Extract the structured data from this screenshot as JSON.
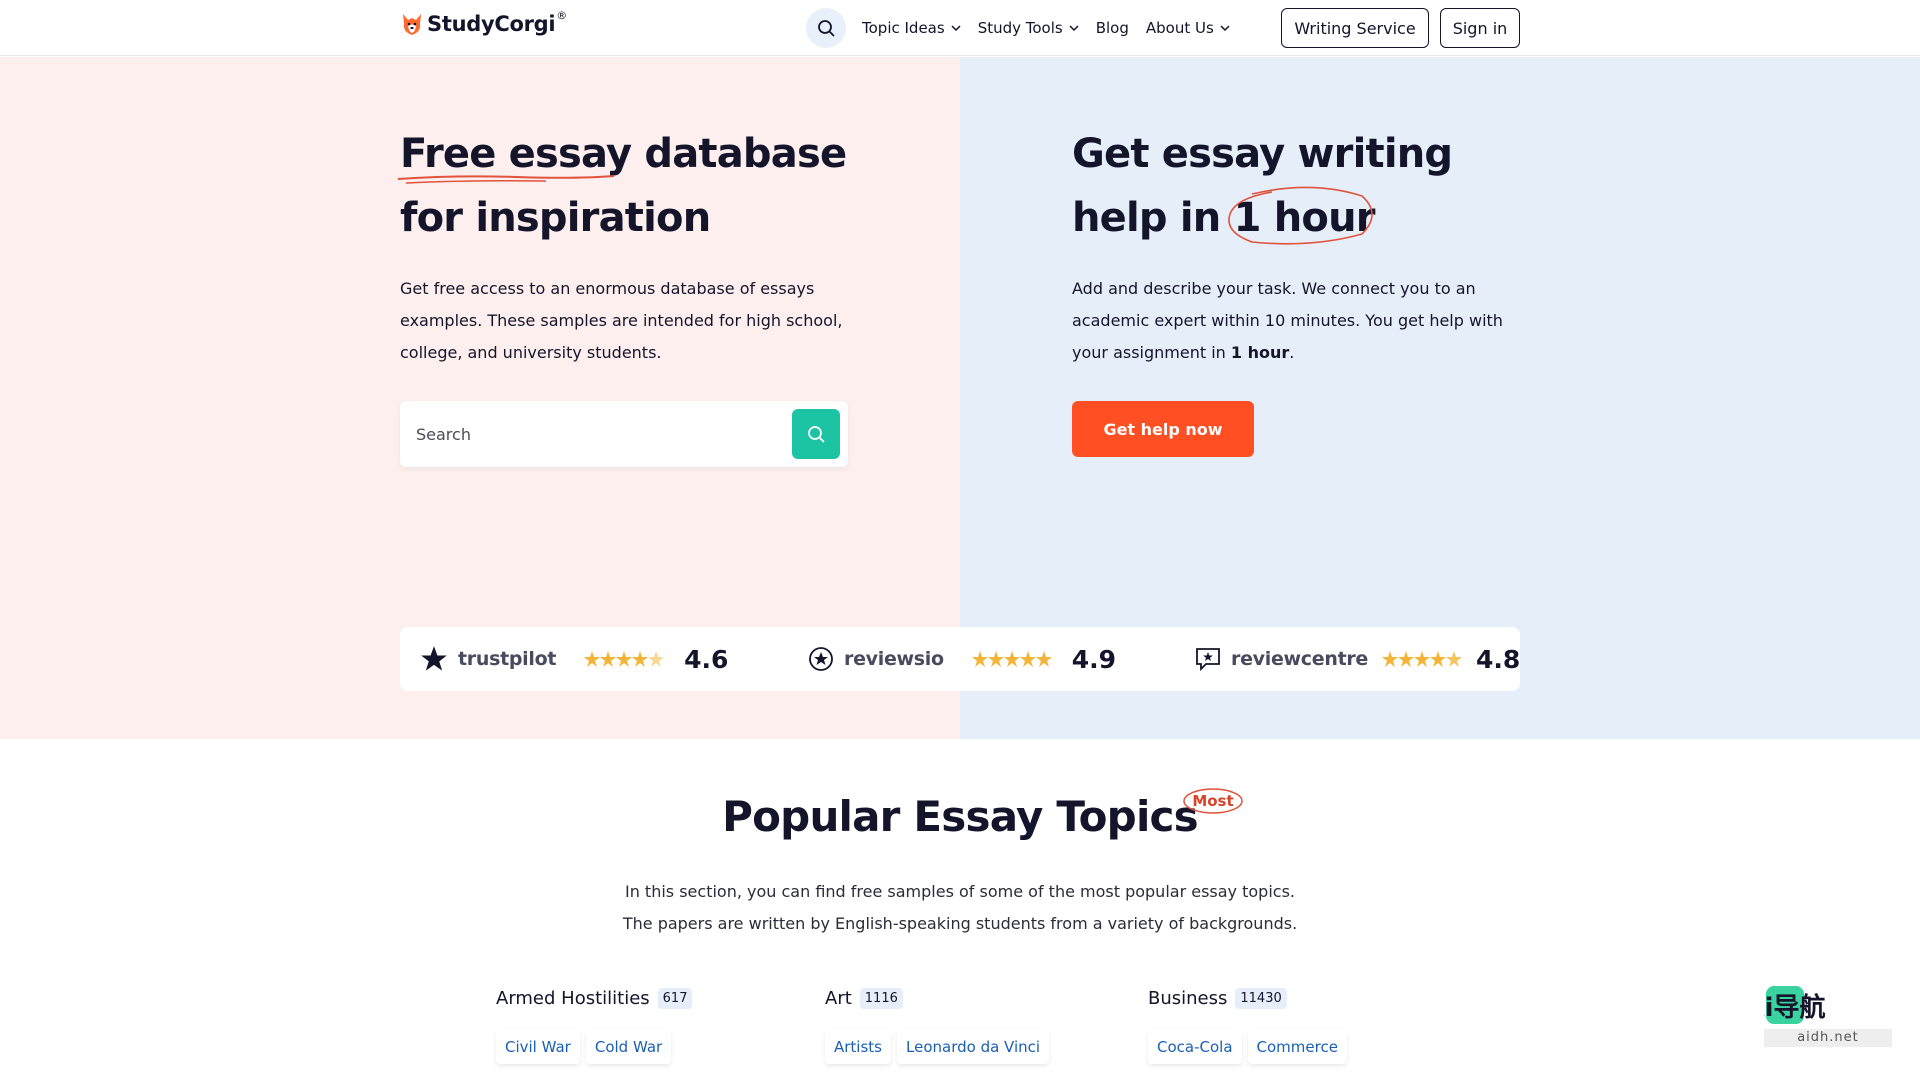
{
  "header": {
    "logo_text": "StudyCorgi",
    "logo_reg": "®",
    "nav": [
      {
        "label": "Topic Ideas",
        "has_dropdown": true
      },
      {
        "label": "Study Tools",
        "has_dropdown": true
      },
      {
        "label": "Blog",
        "has_dropdown": false
      },
      {
        "label": "About Us",
        "has_dropdown": true
      }
    ],
    "writing_service_label": "Writing Service",
    "sign_in_label": "Sign in"
  },
  "hero_left": {
    "title_line1_highlight": "Free essay",
    "title_line1_rest": " database",
    "title_line2": "for inspiration",
    "description": "Get free access to an enormous database of essays examples. These samples are intended for high school, college, and university students.",
    "search_placeholder": "Search"
  },
  "hero_right": {
    "title_line1": "Get essay writing",
    "title_line2_prefix": "help in ",
    "title_line2_highlight": "1 hour",
    "description_before": "Add and describe your task. We connect you to an academic expert within 10 minutes. You get help with your assignment in ",
    "description_bold": "1 hour",
    "description_after": ".",
    "cta_label": "Get help now"
  },
  "ratings": [
    {
      "brand": "trustpilot",
      "score": "4.6",
      "icon": "trustpilot-star-icon"
    },
    {
      "brand": "reviewsio",
      "score": "4.9",
      "icon": "reviewsio-icon"
    },
    {
      "brand": "reviewcentre",
      "score": "4.8",
      "icon": "reviewcentre-icon"
    }
  ],
  "popular": {
    "title": "Popular Essay Topics",
    "badge": "Most",
    "description_line1": "In this section, you can find free samples of some of the most popular essay topics.",
    "description_line2": "The papers are written by English-speaking students from a variety of backgrounds.",
    "categories": [
      {
        "name": "Armed Hostilities",
        "count": "617",
        "tags": [
          "Civil War",
          "Cold War"
        ]
      },
      {
        "name": "Art",
        "count": "1116",
        "tags": [
          "Artists",
          "Leonardo da Vinci"
        ]
      },
      {
        "name": "Business",
        "count": "11430",
        "tags": [
          "Coca-Cola",
          "Commerce"
        ]
      }
    ]
  },
  "watermark": {
    "main": "Ai导航",
    "sub": "aidh.net"
  },
  "colors": {
    "accent_orange": "#ff4f23",
    "accent_teal": "#1cc4a3",
    "hero_left_bg": "#fcefee",
    "hero_right_bg": "#e6eff9",
    "star_gold": "#f4b43a",
    "link_blue": "#1b5fb5"
  }
}
